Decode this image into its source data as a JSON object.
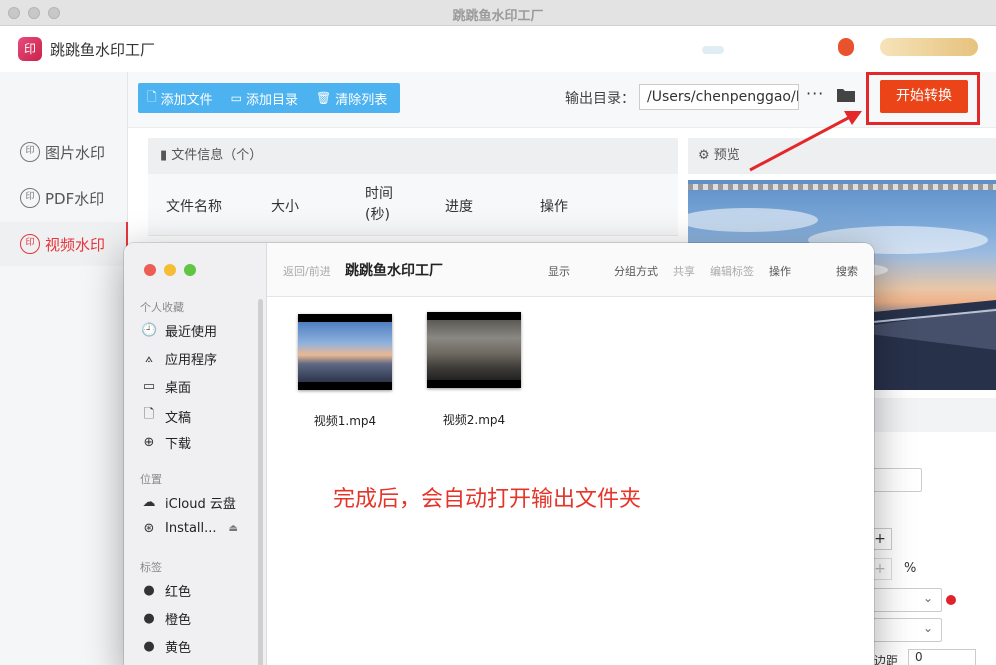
{
  "window": {
    "title": "跳跳鱼水印工厂"
  },
  "header": {
    "app_name": "跳跳鱼水印工厂",
    "logo_text": "印"
  },
  "sidebar": {
    "items": [
      {
        "label": "图片水印",
        "icon": "印",
        "active": false
      },
      {
        "label": "PDF水印",
        "icon": "印",
        "active": false
      },
      {
        "label": "视频水印",
        "icon": "印",
        "active": true
      }
    ]
  },
  "toolbar": {
    "add_file": "添加文件",
    "add_dir": "添加目录",
    "clear_list": "清除列表",
    "output_label": "输出目录：",
    "output_path": "/Users/chenpenggao/D",
    "more": "···",
    "start": "开始转换"
  },
  "file_panel": {
    "header": "文件信息（个）",
    "columns": [
      "文件名称",
      "大小",
      "时间\n(秒)",
      "进度",
      "操作"
    ]
  },
  "preview": {
    "header": "预览"
  },
  "right_panel": {
    "percent": "%",
    "margin_label": "边距",
    "margin_value": "0"
  },
  "finder": {
    "nav": "返回/前进",
    "title": "跳跳鱼水印工厂",
    "menu": [
      {
        "label": "显示",
        "dim": false
      },
      {
        "label": "分组方式",
        "dim": false
      },
      {
        "label": "共享",
        "dim": true
      },
      {
        "label": "编辑标签",
        "dim": true
      },
      {
        "label": "操作",
        "dim": false
      },
      {
        "label": "搜索",
        "dim": false
      }
    ],
    "sections": {
      "favorites": "个人收藏",
      "locations": "位置",
      "tags": "标签"
    },
    "favorites": [
      "最近使用",
      "应用程序",
      "桌面",
      "文稿",
      "下载"
    ],
    "locations": [
      "iCloud 云盘",
      "Install..."
    ],
    "tags": [
      {
        "label": "红色",
        "color": "#111111"
      },
      {
        "label": "橙色",
        "color": "#111111"
      },
      {
        "label": "黄色",
        "color": "#111111"
      }
    ],
    "files": [
      "视频1.mp4",
      "视频2.mp4"
    ],
    "note": "完成后，会自动打开输出文件夹"
  },
  "colors": {
    "accent": "#ea4418",
    "active_nav": "#e8353b",
    "toolbar_btn": "#4db3f0",
    "annotation": "#e22828"
  }
}
